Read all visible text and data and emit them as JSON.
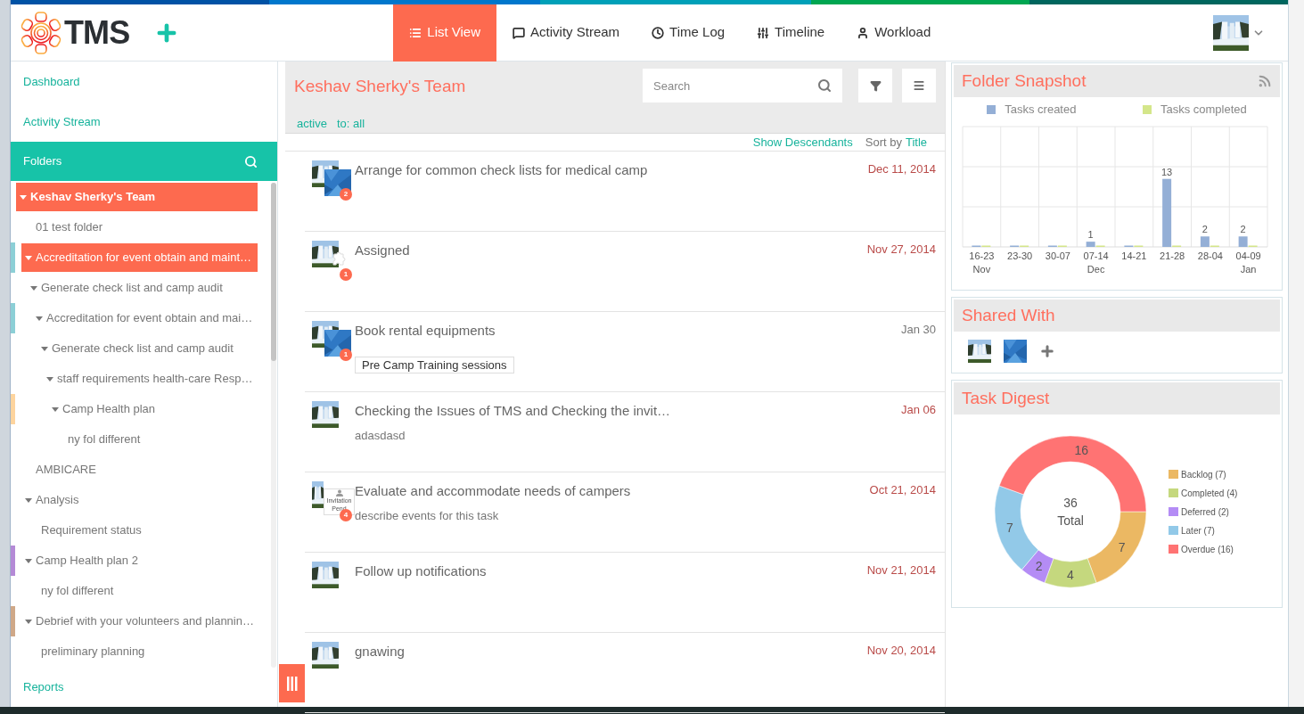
{
  "logo_text": "TMS",
  "nav_tabs": [
    {
      "label": "List View",
      "selected": true
    },
    {
      "label": "Activity Stream",
      "selected": false
    },
    {
      "label": "Time Log",
      "selected": false
    },
    {
      "label": "Timeline",
      "selected": false
    },
    {
      "label": "Workload",
      "selected": false
    }
  ],
  "sidebar": {
    "links_top": [
      "Dashboard",
      "Activity Stream"
    ],
    "folders_header": "Folders",
    "links_bottom": [
      "Reports"
    ],
    "tree": [
      {
        "label": "Keshav Sherky's Team",
        "selected": true,
        "expanded": true,
        "children": [
          {
            "label": "01 test folder",
            "selected": false
          },
          {
            "label": "Accreditation for event obtain and maint…",
            "selected": true,
            "expanded": true,
            "color": "#8ccfd6",
            "children": [
              {
                "label": "Generate check list and camp audit",
                "selected": false,
                "expanded": true,
                "children": [
                  {
                    "label": "Accreditation for event obtain and mai…",
                    "selected": false,
                    "expanded": true,
                    "color": "#8ccfd6",
                    "children": [
                      {
                        "label": "Generate check list and camp audit",
                        "selected": false,
                        "expanded": true,
                        "children": [
                          {
                            "label": "staff requirements health-care Resp…",
                            "selected": false,
                            "expanded": true,
                            "children": [
                              {
                                "label": "Camp Health plan",
                                "selected": false,
                                "expanded": true,
                                "color": "#fdd49e",
                                "children": [
                                  {
                                    "label": "ny fol different",
                                    "selected": false
                                  }
                                ]
                              }
                            ]
                          }
                        ]
                      }
                    ]
                  }
                ]
              }
            ]
          },
          {
            "label": "AMBICARE",
            "selected": false
          },
          {
            "label": "Analysis",
            "selected": false,
            "expanded": true,
            "children": [
              {
                "label": "Requirement status",
                "selected": false
              }
            ]
          },
          {
            "label": "Camp Health plan 2",
            "selected": false,
            "expanded": true,
            "color": "#b48ad6",
            "children": [
              {
                "label": "ny fol different",
                "selected": false
              }
            ]
          },
          {
            "label": "Debrief with your volunteers and plannin…",
            "selected": false,
            "expanded": true,
            "color": "#cfa888",
            "children": [
              {
                "label": "preliminary planning",
                "selected": false
              }
            ]
          }
        ]
      }
    ]
  },
  "list": {
    "title": "Keshav Sherky's Team",
    "search": {
      "placeholder": "Search"
    },
    "filters": [
      "active",
      "to: all"
    ],
    "show_descendants": "Show Descendants",
    "sort_label": "Sort by",
    "sort_field": "Title",
    "tasks": [
      {
        "title": "Arrange for common check lists for medical camp",
        "date": "Dec 11, 2014",
        "overdue": true,
        "badge": "2"
      },
      {
        "title": "Assigned",
        "date": "Nov 27, 2014",
        "overdue": true,
        "badge": "1",
        "second_avatar": {
          "kind": "placeholder"
        }
      },
      {
        "title": "Book rental equipments",
        "date": "Jan 30",
        "overdue": false,
        "badge": "1",
        "tag": "Pre Camp Training sessions"
      },
      {
        "title": "Checking the Issues of TMS and Checking the invit…",
        "date": "Jan 06",
        "overdue": true,
        "description": "adasdasd"
      },
      {
        "title": "Evaluate and accommodate needs of campers",
        "date": "Oct 21, 2014",
        "overdue": true,
        "badge": "4",
        "description": "describe events for this task",
        "second_avatar": {
          "kind": "invitation",
          "label": "Invitation Pend"
        }
      },
      {
        "title": "Follow up notifications",
        "date": "Nov 21, 2014",
        "overdue": true
      },
      {
        "title": "gnawing",
        "date": "Nov 20, 2014",
        "overdue": true
      }
    ]
  },
  "snapshot": {
    "title": "Folder Snapshot",
    "chart_data": {
      "type": "bar",
      "categories": [
        "16-23 Nov",
        "23-30",
        "30-07",
        "07-14 Dec",
        "14-21",
        "21-28",
        "28-04",
        "04-09 Jan"
      ],
      "series": [
        {
          "name": "Tasks created",
          "color": "#94afd6",
          "values": [
            null,
            null,
            null,
            1,
            null,
            13,
            2,
            2
          ]
        },
        {
          "name": "Tasks completed",
          "color": "#d4e68a",
          "values": [
            null,
            null,
            null,
            null,
            null,
            null,
            null,
            null
          ]
        }
      ],
      "data_labels": true
    }
  },
  "shared": {
    "title": "Shared With"
  },
  "digest": {
    "title": "Task Digest",
    "total": "36",
    "total_label": "Total",
    "legend": [
      {
        "label": "Backlog (7)",
        "color": "#ebb863"
      },
      {
        "label": "Completed (4)",
        "color": "#c5d87e"
      },
      {
        "label": "Deferred (2)",
        "color": "#b48cf5"
      },
      {
        "label": "Later (7)",
        "color": "#92c9e8"
      },
      {
        "label": "Overdue (16)",
        "color": "#ff7373"
      }
    ],
    "chart_data": {
      "type": "donut",
      "values": [
        7,
        4,
        2,
        7,
        16
      ],
      "data_labels": true
    }
  }
}
